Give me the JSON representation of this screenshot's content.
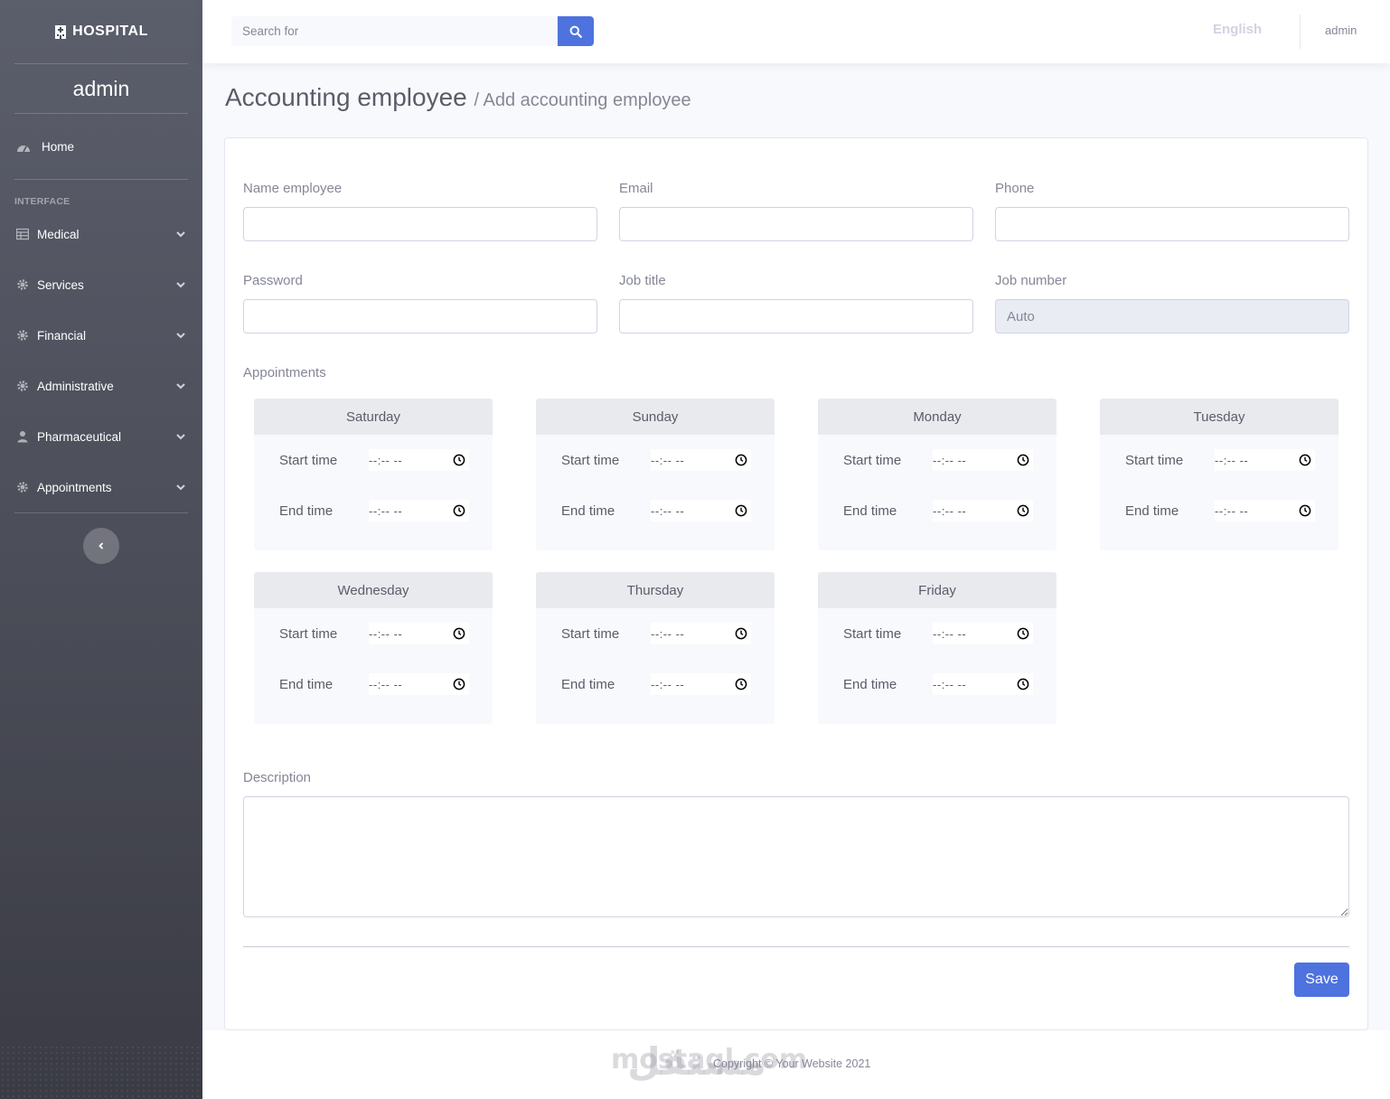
{
  "sidebar": {
    "brand": "HOSPITAL",
    "user": "admin",
    "home_label": "Home",
    "heading": "INTERFACE",
    "items": [
      {
        "label": "Medical",
        "icon": "table-icon"
      },
      {
        "label": "Services",
        "icon": "gear-icon"
      },
      {
        "label": "Financial",
        "icon": "gear-icon"
      },
      {
        "label": "Administrative",
        "icon": "gear-icon"
      },
      {
        "label": "Pharmaceutical",
        "icon": "user-icon"
      },
      {
        "label": "Appointments",
        "icon": "gear-icon"
      }
    ]
  },
  "topbar": {
    "search_placeholder": "Search for",
    "language": "English",
    "user": "admin"
  },
  "page": {
    "title": "Accounting employee",
    "subtitle": "/ Add accounting employee"
  },
  "form": {
    "name_label": "Name employee",
    "email_label": "Email",
    "phone_label": "Phone",
    "password_label": "Password",
    "job_title_label": "Job title",
    "job_number_label": "Job number",
    "job_number_value": "Auto",
    "appointments_label": "Appointments",
    "start_label": "Start time",
    "end_label": "End time",
    "time_placeholder": "--:-- --",
    "days": [
      "Saturday",
      "Sunday",
      "Monday",
      "Tuesday",
      "Wednesday",
      "Thursday",
      "Friday"
    ],
    "description_label": "Description",
    "save_label": "Save"
  },
  "footer": {
    "copyright": "Copyright © Your Website 2021",
    "watermark_latin": "mostaql.com",
    "watermark_arabic": "مستقل"
  },
  "colors": {
    "primary": "#4e73df",
    "sidebar_top": "#5b5e6b",
    "sidebar_bottom": "#3a3b44"
  }
}
